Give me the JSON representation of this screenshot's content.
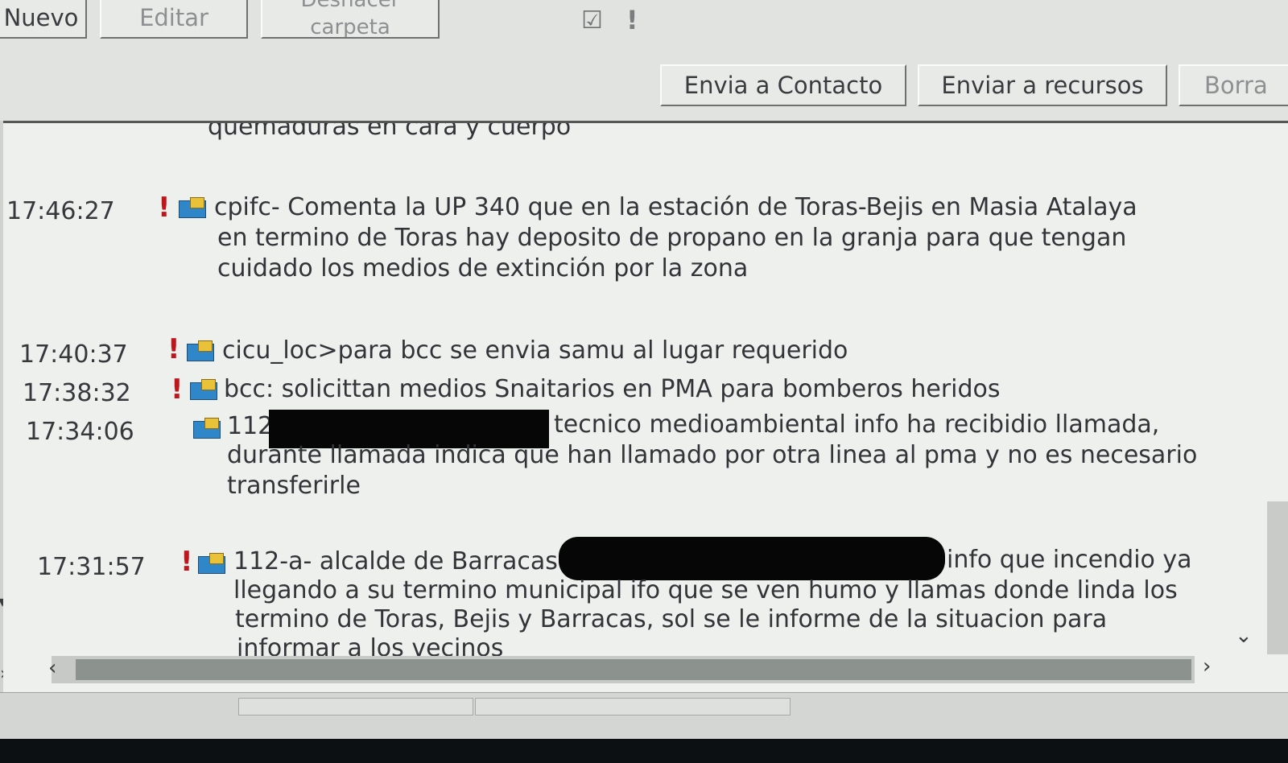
{
  "toolbar": {
    "nuevo": "Nuevo",
    "editar": "Editar",
    "deshacer_line1": "Deshacer",
    "deshacer_line2": "carpeta",
    "envia_contacto": "Envia a Contacto",
    "enviar_recursos": "Enviar a recursos",
    "borrar": "Borra"
  },
  "messages": {
    "m0": {
      "lines": [
        "quemaduras en cara y cuerpo"
      ]
    },
    "m1": {
      "time": "17:46:27",
      "high_priority": true,
      "lines": [
        "cpifc- Comenta la UP 340 que en la estación de Toras-Bejis en Masia Atalaya",
        "en termino de Toras hay deposito de propano en la granja para que tengan",
        "cuidado los medios de extinción por la zona"
      ]
    },
    "m2": {
      "time": "17:40:37",
      "high_priority": true,
      "lines": [
        "cicu_loc>para bcc se envia samu al lugar requerido"
      ]
    },
    "m3": {
      "time": "17:38:32",
      "high_priority": true,
      "lines": [
        "bcc: solicittan medios Snaitarios en PMA para bomberos heridos"
      ]
    },
    "m4": {
      "time": "17:34:06",
      "high_priority": false,
      "prefix": "112",
      "lines": [
        "tecnico medioambiental info ha recibidio llamada,",
        "durante llamada indica que han llamado por otra linea al pma y no es necesario",
        "transferirle"
      ]
    },
    "m5": {
      "time": "17:31:57",
      "high_priority": true,
      "prefix": "112-a- alcalde de Barracas",
      "lines": [
        "info que incendio ya",
        "llegando a su termino municipal ifo que se ven humo y llamas donde linda los",
        "termino de Toras, Bejis y Barracas, sol se le informe de la situacion para",
        "informar a los vecinos"
      ]
    }
  },
  "icons": {
    "priority": "!",
    "flag": "checkbox-flag-icon",
    "folder": "folder-note-icon",
    "left": "‹",
    "right": "›",
    "down": "⌄"
  },
  "colors": {
    "priority_red": "#c0151c",
    "folder_blue": "#2f86c9",
    "note_yellow": "#e9c23a"
  }
}
